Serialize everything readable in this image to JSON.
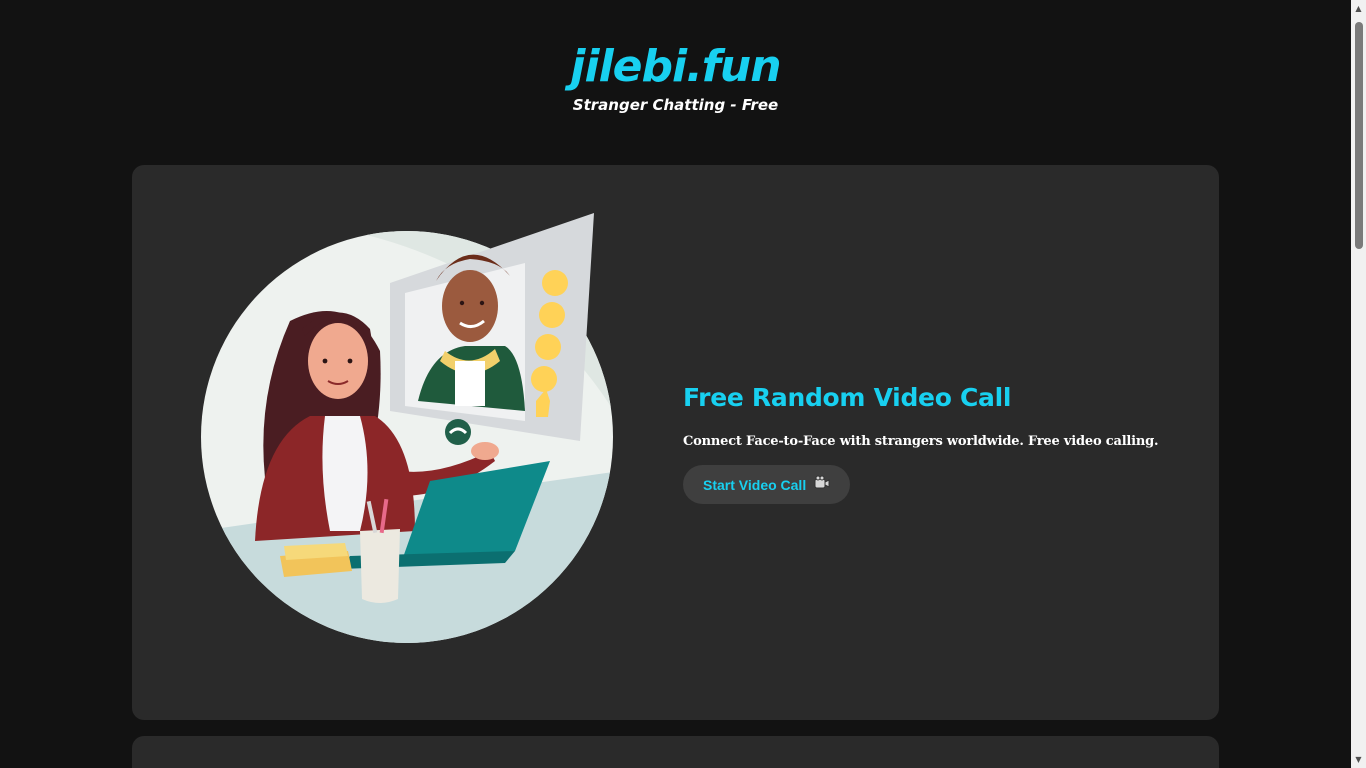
{
  "header": {
    "logo": "jilebi.fun",
    "tagline": "Stranger Chatting - Free"
  },
  "feature": {
    "title": "Free Random Video Call",
    "description": "Connect Face-to-Face with strangers worldwide. Free video calling.",
    "button_label": "Start Video Call",
    "button_icon": "video-camera-icon"
  },
  "colors": {
    "background": "#121212",
    "card": "#2a2a2a",
    "accent": "#18d0f0",
    "button": "#3f3f3f"
  },
  "scrollbar": {
    "up_arrow": "▲",
    "down_arrow": "▼"
  }
}
